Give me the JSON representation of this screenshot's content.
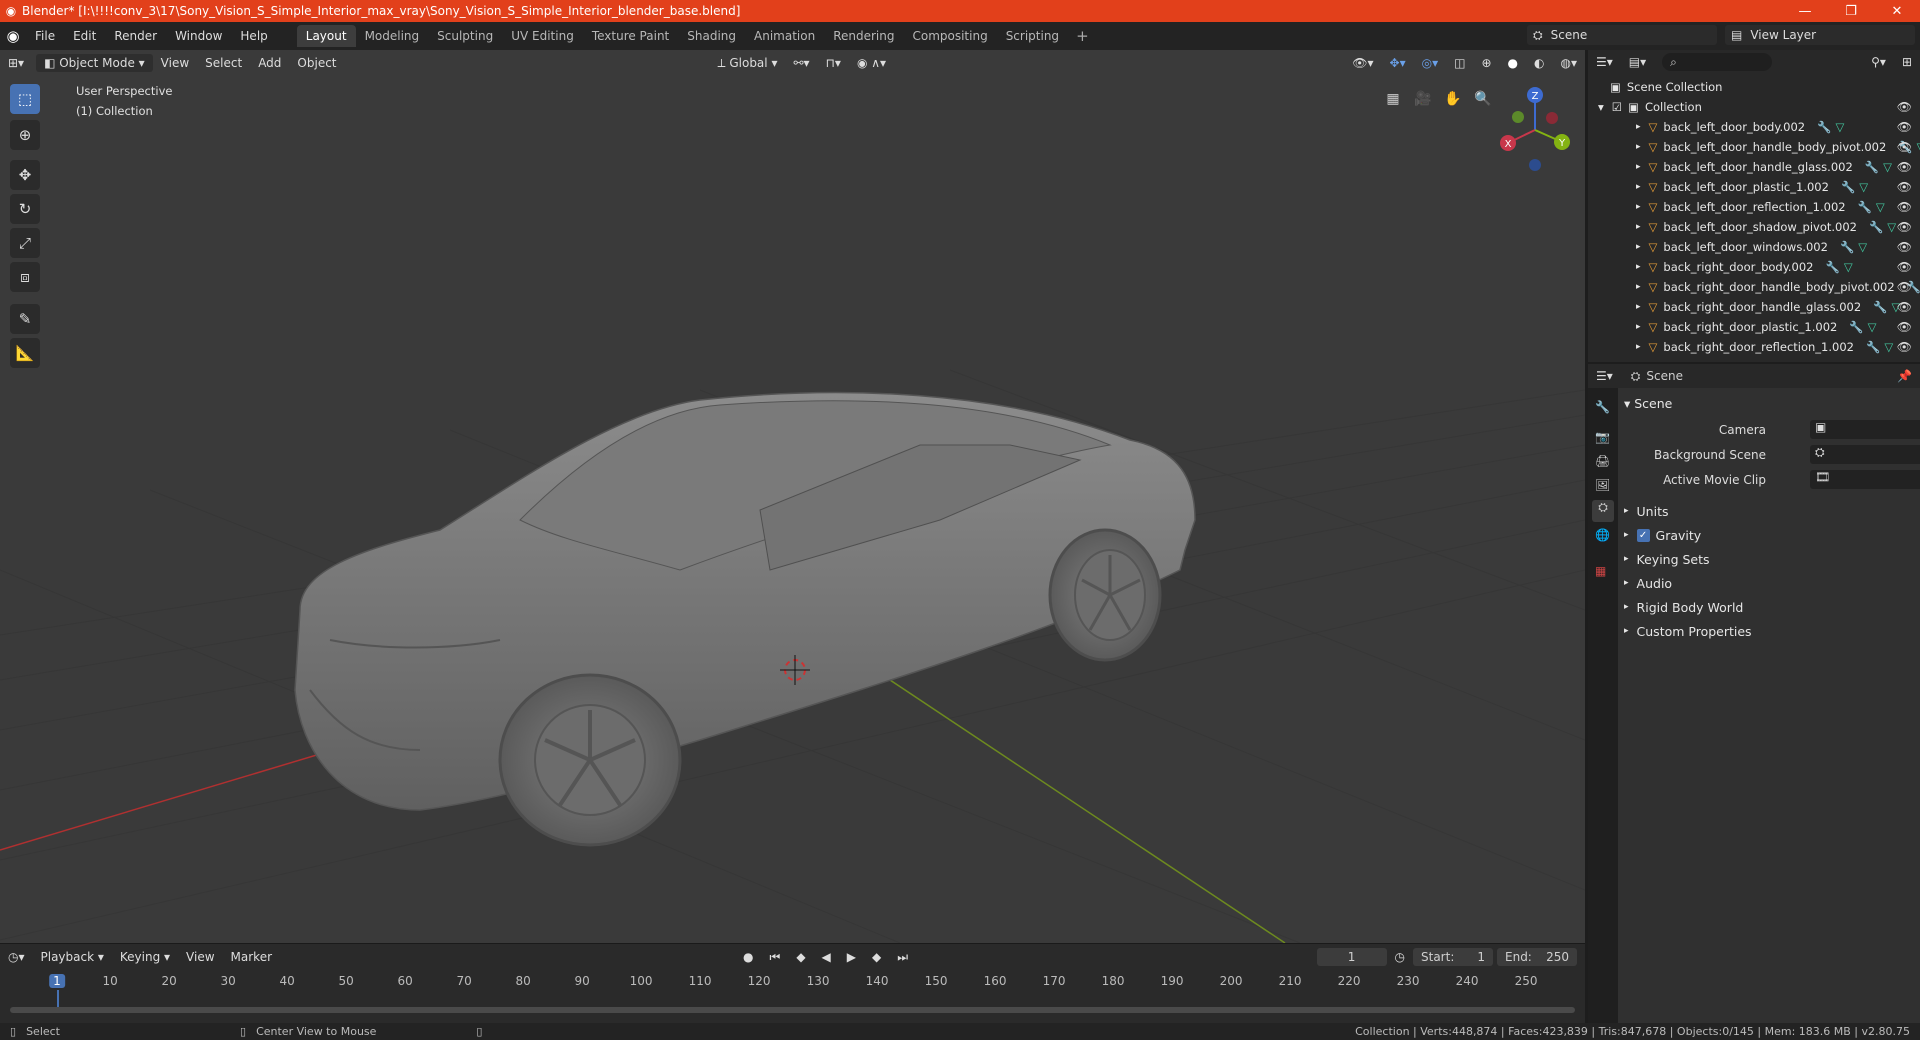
{
  "titlebar": {
    "title": "Blender* [I:\\!!!!conv_3\\17\\Sony_Vision_S_Simple_Interior_max_vray\\Sony_Vision_S_Simple_Interior_blender_base.blend]",
    "minimize": "—",
    "maximize": "❐",
    "close": "✕"
  },
  "menus": [
    "File",
    "Edit",
    "Render",
    "Window",
    "Help"
  ],
  "workspaces": [
    "Layout",
    "Modeling",
    "Sculpting",
    "UV Editing",
    "Texture Paint",
    "Shading",
    "Animation",
    "Rendering",
    "Compositing",
    "Scripting"
  ],
  "scene_field": "Scene",
  "view_layer_field": "View Layer",
  "viewport": {
    "mode": "Object Mode",
    "menus": [
      "View",
      "Select",
      "Add",
      "Object"
    ],
    "orientation": "Global",
    "perspective": "User Perspective",
    "collection": "(1) Collection",
    "gizmo": {
      "x": "X",
      "y": "Y",
      "z": "Z"
    }
  },
  "timeline": {
    "menus": [
      "Playback",
      "Keying",
      "View",
      "Marker"
    ],
    "current_frame": "1",
    "start_label": "Start:",
    "start": "1",
    "end_label": "End:",
    "end": "250",
    "ticks": [
      "1",
      "10",
      "20",
      "30",
      "40",
      "50",
      "60",
      "70",
      "80",
      "90",
      "100",
      "110",
      "120",
      "130",
      "140",
      "150",
      "160",
      "170",
      "180",
      "190",
      "200",
      "210",
      "220",
      "230",
      "240",
      "250"
    ]
  },
  "statusbar": {
    "select": "Select",
    "center": "Center View to Mouse",
    "stats": "Collection | Verts:448,874 | Faces:423,839 | Tris:847,678 | Objects:0/145 | Mem: 183.6 MB | v2.80.75"
  },
  "outliner": {
    "root": "Scene Collection",
    "collection": "Collection",
    "items": [
      "back_left_door_body.002",
      "back_left_door_handle_body_pivot.002",
      "back_left_door_handle_glass.002",
      "back_left_door_plastic_1.002",
      "back_left_door_reflection_1.002",
      "back_left_door_shadow_pivot.002",
      "back_left_door_windows.002",
      "back_right_door_body.002",
      "back_right_door_handle_body_pivot.002",
      "back_right_door_handle_glass.002",
      "back_right_door_plastic_1.002",
      "back_right_door_reflection_1.002"
    ]
  },
  "properties": {
    "context": "Scene",
    "panel": "Scene",
    "camera_label": "Camera",
    "background_label": "Background Scene",
    "movie_label": "Active Movie Clip",
    "sections": [
      "Units",
      "Gravity",
      "Keying Sets",
      "Audio",
      "Rigid Body World",
      "Custom Properties"
    ]
  }
}
